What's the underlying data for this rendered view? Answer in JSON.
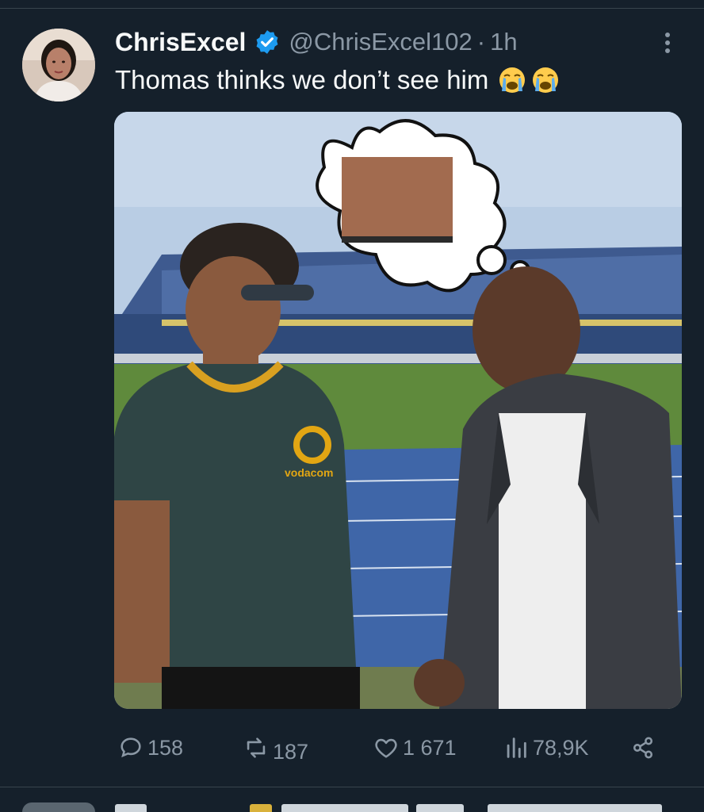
{
  "tweet": {
    "display_name": "ChrisExcel",
    "handle": "@ChrisExcel102",
    "separator": "·",
    "time": "1h",
    "text": "Thomas thinks we don’t see him",
    "emojis": [
      "loudly-crying-face",
      "loudly-crying-face"
    ]
  },
  "media": {
    "description_icon": "photo-image",
    "jersey_text": "vodacom"
  },
  "actions": {
    "replies": "158",
    "reposts": "187",
    "likes": "1 671",
    "views": "78,9K"
  },
  "colors": {
    "background": "#15202b",
    "text_primary": "#f7f9f9",
    "text_secondary": "#8b98a5",
    "verified": "#1d9bf0",
    "divider": "#38444d"
  }
}
